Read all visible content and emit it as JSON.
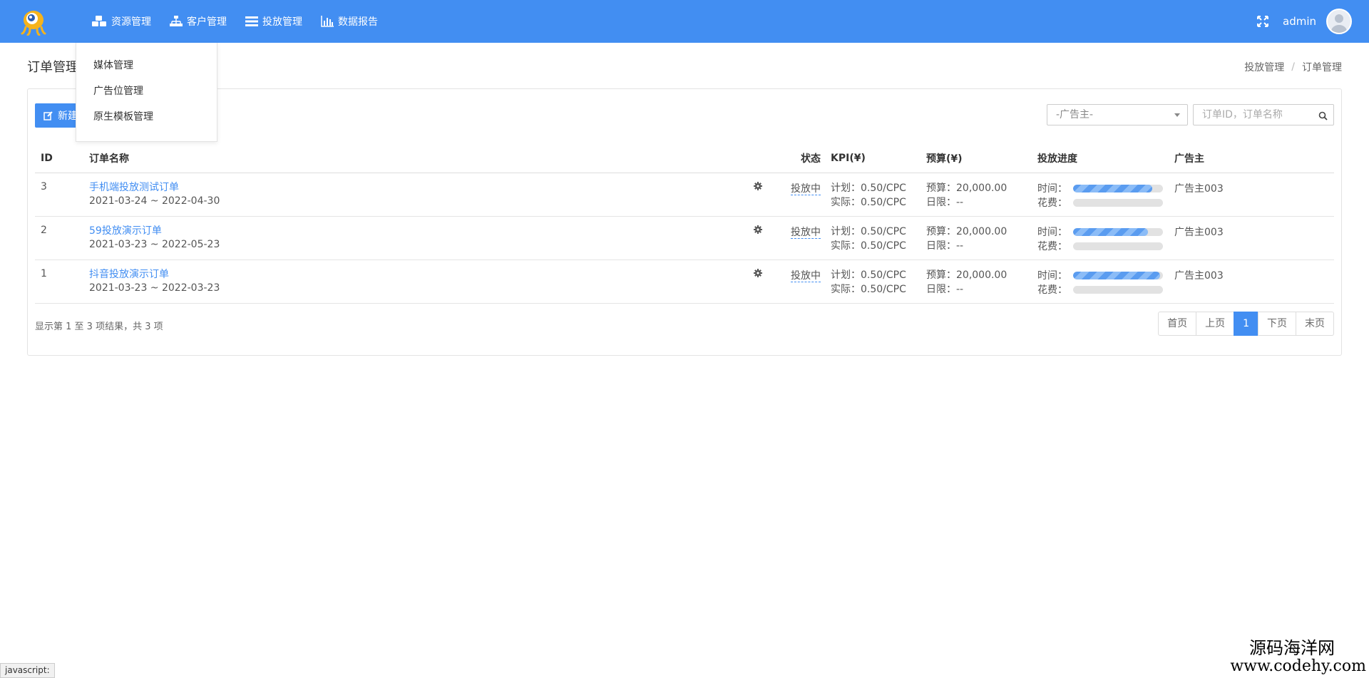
{
  "header": {
    "nav": [
      {
        "label": "资源管理",
        "icon": "cubes-icon"
      },
      {
        "label": "客户管理",
        "icon": "sitemap-icon"
      },
      {
        "label": "投放管理",
        "icon": "list-icon"
      },
      {
        "label": "数据报告",
        "icon": "bar-chart-icon"
      }
    ],
    "username": "admin",
    "accent_color": "#428ef2"
  },
  "dropdown": {
    "items": [
      "媒体管理",
      "广告位管理",
      "原生模板管理"
    ]
  },
  "page": {
    "title": "订单管理",
    "breadcrumb": [
      "投放管理",
      "订单管理"
    ],
    "breadcrumb_sep": "/"
  },
  "toolbar": {
    "new_label": "新建",
    "advertiser_select": "-广告主-",
    "search_placeholder": "订单ID，订单名称"
  },
  "table": {
    "headers": {
      "id": "ID",
      "name": "订单名称",
      "status": "状态",
      "kpi": "KPI(¥)",
      "budget": "预算(¥)",
      "progress": "投放进度",
      "advertiser": "广告主"
    },
    "labels": {
      "kpi_plan": "计划：",
      "kpi_actual": "实际：",
      "budget_total": "预算：",
      "budget_daily": "日限：",
      "prog_time": "时间：",
      "prog_cost": "花费："
    },
    "rows": [
      {
        "id": "3",
        "name": "手机端投放测试订单",
        "date": "2021-03-24 ~ 2022-04-30",
        "status": "投放中",
        "kpi_plan": "0.50/CPC",
        "kpi_actual": "0.50/CPC",
        "budget": "20,000.00",
        "daily": "--",
        "time_progress": 0.88,
        "cost_progress": 0.0,
        "advertiser": "广告主003"
      },
      {
        "id": "2",
        "name": "59投放演示订单",
        "date": "2021-03-23 ~ 2022-05-23",
        "status": "投放中",
        "kpi_plan": "0.50/CPC",
        "kpi_actual": "0.50/CPC",
        "budget": "20,000.00",
        "daily": "--",
        "time_progress": 0.83,
        "cost_progress": 0.0,
        "advertiser": "广告主003"
      },
      {
        "id": "1",
        "name": "抖音投放演示订单",
        "date": "2021-03-23 ~ 2022-03-23",
        "status": "投放中",
        "kpi_plan": "0.50/CPC",
        "kpi_actual": "0.50/CPC",
        "budget": "20,000.00",
        "daily": "--",
        "time_progress": 0.97,
        "cost_progress": 0.0,
        "advertiser": "广告主003"
      }
    ]
  },
  "footer": {
    "summary": "显示第 1 至 3 项结果，共 3 项",
    "pager": {
      "first": "首页",
      "prev": "上页",
      "current": "1",
      "next": "下页",
      "last": "末页"
    }
  },
  "statusbar": "javascript:",
  "watermark": {
    "line1": "源码海洋网",
    "line2": "www.codehy.com"
  }
}
